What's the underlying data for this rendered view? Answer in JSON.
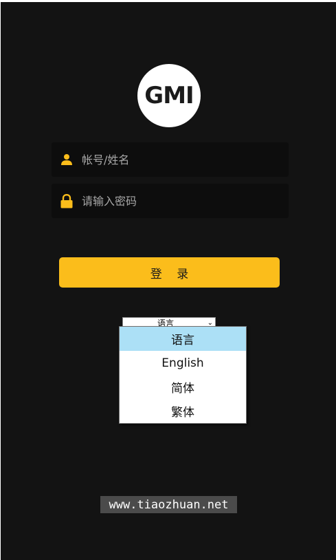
{
  "logo": {
    "text": "GMI"
  },
  "form": {
    "username": {
      "placeholder": "帐号/姓名",
      "icon": "user-icon"
    },
    "password": {
      "placeholder": "请输入密码",
      "icon": "lock-icon"
    },
    "login_label": "登 录"
  },
  "language": {
    "selected": "语言",
    "options": [
      "语言",
      "English",
      "简体",
      "繁体"
    ],
    "highlighted_index": 0
  },
  "watermark": "www.tiaozhuan.net",
  "colors": {
    "background": "#131313",
    "field_bg": "#0d0d0d",
    "accent": "#fbbd1b",
    "dropdown_highlight": "#ace0f6"
  }
}
